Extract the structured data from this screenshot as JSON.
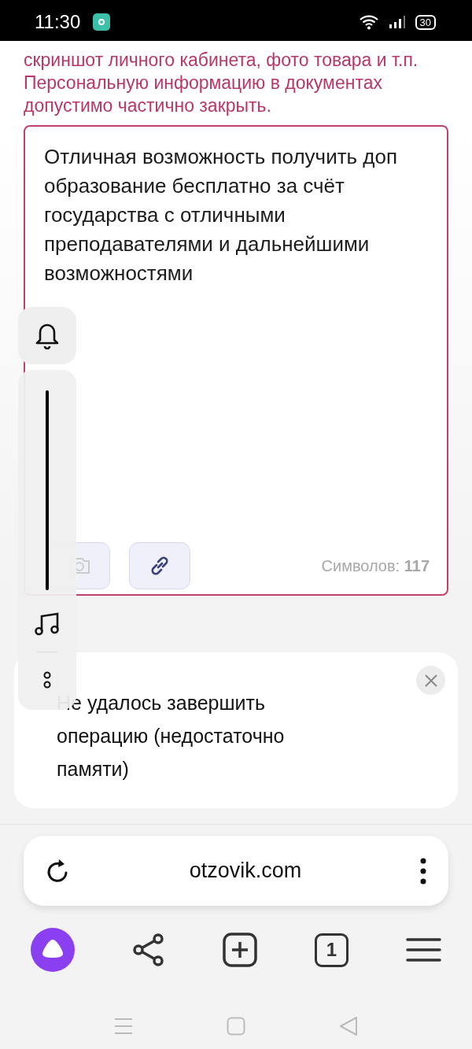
{
  "status_bar": {
    "time": "11:30",
    "battery": "30"
  },
  "instructions": "скриншот личного кабинета, фото товара и т.п. Персональную информацию в документах допустимо частично закрыть.",
  "review_field": {
    "value": "Отличная возможность получить доп образование бесплатно за счёт государства с отличными преподавателями и дальнейшими возможностями",
    "counter": "Символов: **117**"
  },
  "volume_panel": {
    "level": 1
  },
  "toast": {
    "message": "Не удалось завершить операцию (недостаточно памяти)"
  },
  "address_bar": {
    "url": "otzovik.com"
  },
  "toolbar": {
    "tab_count": "1"
  }
}
